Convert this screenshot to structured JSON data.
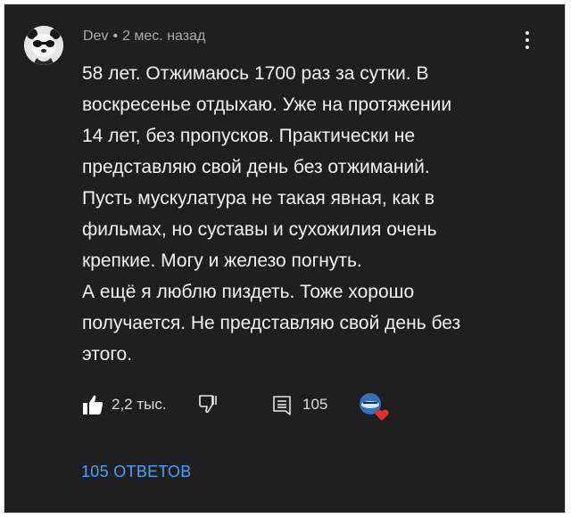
{
  "comment": {
    "author": "Dev",
    "separator": "•",
    "timestamp": "2 мес. назад",
    "lines": [
      "58 лет. Отжимаюсь 1700 раз за сутки. В",
      "воскресенье отдыхаю. Уже на протяжении",
      "14 лет, без пропусков. Практически не",
      "представляю свой день без отжиманий.",
      "Пусть мускулатура не такая явная, как в",
      "фильмах, но суставы и сухожилия очень",
      "крепкие. Могу и железо погнуть.",
      "А ещё я люблю пиздеть. Тоже хорошо",
      "получается. Не представляю свой день без",
      "этого."
    ]
  },
  "actions": {
    "like_count": "2,2 тыс.",
    "reply_count": "105"
  },
  "replies": {
    "label": "105 ОТВЕТОВ"
  },
  "icons": {
    "like": "thumbs-up-icon",
    "dislike": "thumbs-down-icon",
    "reply": "comment-icon",
    "menu": "more-vertical-icon",
    "creator_heart": "creator-heart-icon"
  },
  "colors": {
    "background": "#1f1f1f",
    "text": "#f1f1f1",
    "meta": "#aaaaaa",
    "link": "#3ea6ff",
    "heart": "#e32d32"
  }
}
